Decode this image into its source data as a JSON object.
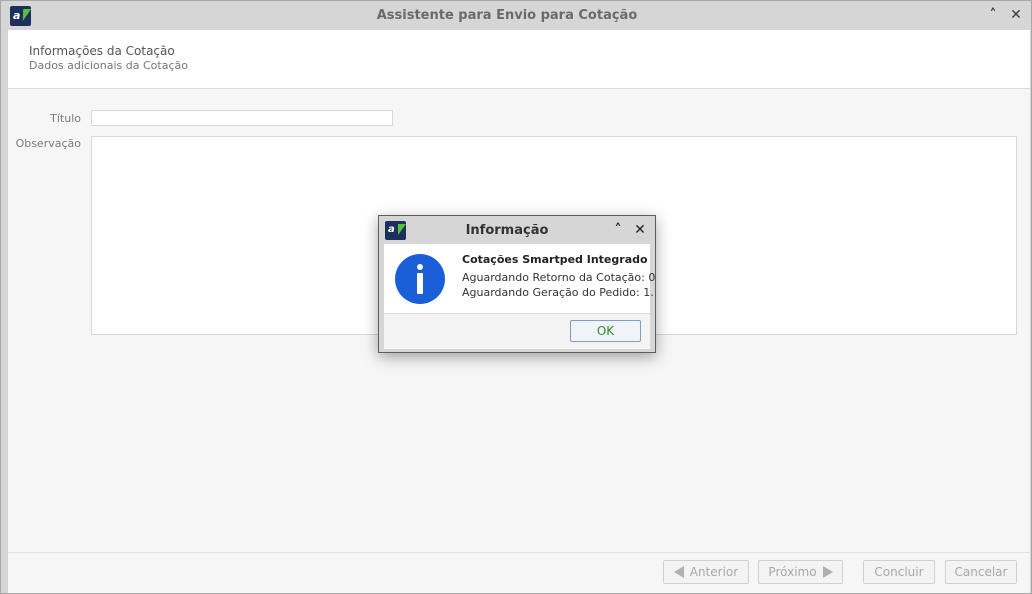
{
  "window": {
    "title": "Assistente para Envio para Cotação",
    "logo_text": "a"
  },
  "header": {
    "title": "Informações da Cotação",
    "subtitle": "Dados adicionais da Cotação"
  },
  "form": {
    "titulo_label": "Título",
    "titulo_value": "",
    "observacao_label": "Observação",
    "observacao_value": ""
  },
  "wizard_buttons": {
    "anterior": "Anterior",
    "proximo": "Próximo",
    "concluir": "Concluir",
    "cancelar": "Cancelar"
  },
  "dialog": {
    "title": "Informação",
    "logo_text": "a",
    "message_title": "Cotações Smartped Integrado",
    "line1": "Aguardando Retorno da Cotação: 0",
    "line2": "Aguardando Geração do Pedido: 1.",
    "ok_label": "OK"
  },
  "icons": {
    "minimize": "chevron-up-icon",
    "close": "close-icon",
    "info": "info-icon"
  },
  "colors": {
    "info_icon": "#1b5fd8",
    "ok_text": "#2e8a2e",
    "logo_bg": "#1d2f5c",
    "logo_accent": "#56c23b"
  }
}
